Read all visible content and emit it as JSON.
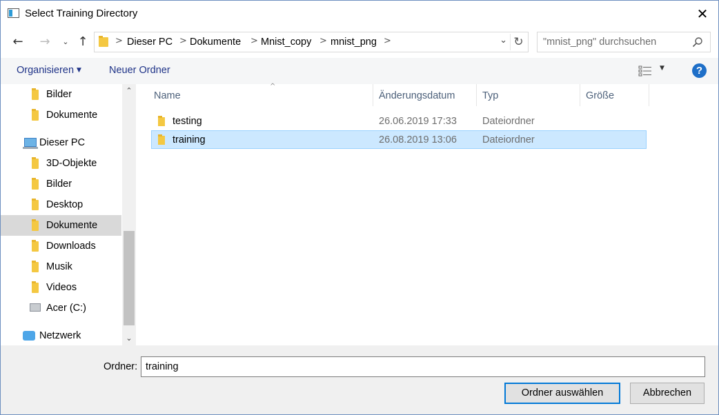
{
  "window": {
    "title": "Select Training Directory",
    "close_glyph": "✕"
  },
  "nav": {
    "back_glyph": "←",
    "forward_glyph": "→",
    "history_glyph": "⌄",
    "up_glyph": "↑",
    "breadcrumb": [
      "Dieser PC",
      "Dokumente",
      "Mnist_copy",
      "mnist_png"
    ],
    "separator_glyph": ">",
    "address_dropdown_glyph": "⌄",
    "refresh_glyph": "↻",
    "search_placeholder": "\"mnist_png\" durchsuchen"
  },
  "toolbar": {
    "organize_label": "Organisieren",
    "organize_caret": "▼",
    "new_folder_label": "Neuer Ordner",
    "view_dropdown_glyph": "▼",
    "help_glyph": "?"
  },
  "sidebar": {
    "items": [
      {
        "label": "Bilder",
        "icon": "folder-icon"
      },
      {
        "label": "Dokumente",
        "icon": "folder-icon"
      },
      {
        "label": "Dieser PC",
        "icon": "computer-icon"
      },
      {
        "label": "3D-Objekte",
        "icon": "3d-objects-folder-icon"
      },
      {
        "label": "Bilder",
        "icon": "pictures-folder-icon"
      },
      {
        "label": "Desktop",
        "icon": "desktop-folder-icon"
      },
      {
        "label": "Dokumente",
        "icon": "documents-folder-icon"
      },
      {
        "label": "Downloads",
        "icon": "downloads-folder-icon"
      },
      {
        "label": "Musik",
        "icon": "music-folder-icon"
      },
      {
        "label": "Videos",
        "icon": "videos-folder-icon"
      },
      {
        "label": "Acer (C:)",
        "icon": "drive-icon"
      },
      {
        "label": "Netzwerk",
        "icon": "network-icon"
      }
    ],
    "selected": "Dokumente",
    "scroll_up_glyph": "⌃",
    "scroll_down_glyph": "⌄"
  },
  "filelist": {
    "columns": [
      "Name",
      "Änderungsdatum",
      "Typ",
      "Größe"
    ],
    "sort_glyph": "^",
    "rows": [
      {
        "name": "testing",
        "date": "26.06.2019 17:33",
        "type": "Dateiordner",
        "size": ""
      },
      {
        "name": "training",
        "date": "26.08.2019 13:06",
        "type": "Dateiordner",
        "size": ""
      }
    ],
    "selected_row": "training"
  },
  "footer": {
    "folder_label": "Ordner:",
    "folder_value": "training",
    "select_button": "Ordner auswählen",
    "cancel_button": "Abbrechen"
  },
  "colors": {
    "accent": "#0078d7",
    "selection_bg": "#cce8ff",
    "selection_border": "#99d1ff",
    "folder_yellow": "#f4c842",
    "toolbar_text": "#1e3287"
  }
}
